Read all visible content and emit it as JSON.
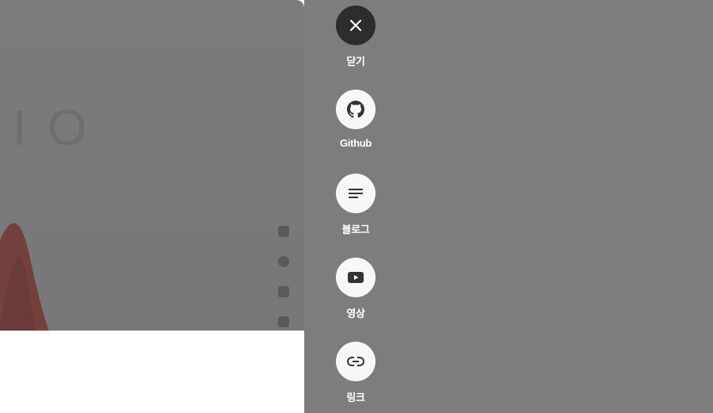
{
  "share_menu": {
    "items": [
      {
        "id": "close",
        "label": "닫기",
        "icon": "close-icon",
        "theme": "dark"
      },
      {
        "id": "github",
        "label": "Github",
        "icon": "github-icon",
        "theme": "light"
      },
      {
        "id": "blog",
        "label": "블로그",
        "icon": "blog-lines-icon",
        "theme": "light"
      },
      {
        "id": "video",
        "label": "영상",
        "icon": "youtube-icon",
        "theme": "light"
      },
      {
        "id": "link",
        "label": "링크",
        "icon": "link-icon",
        "theme": "light"
      }
    ]
  },
  "colors": {
    "panel_bg": "#7d7d80",
    "close_btn_bg": "#2d2d2d",
    "icon_btn_bg": "#f7f7f7",
    "icon_color": "#333333",
    "label_color": "#ffffff"
  }
}
